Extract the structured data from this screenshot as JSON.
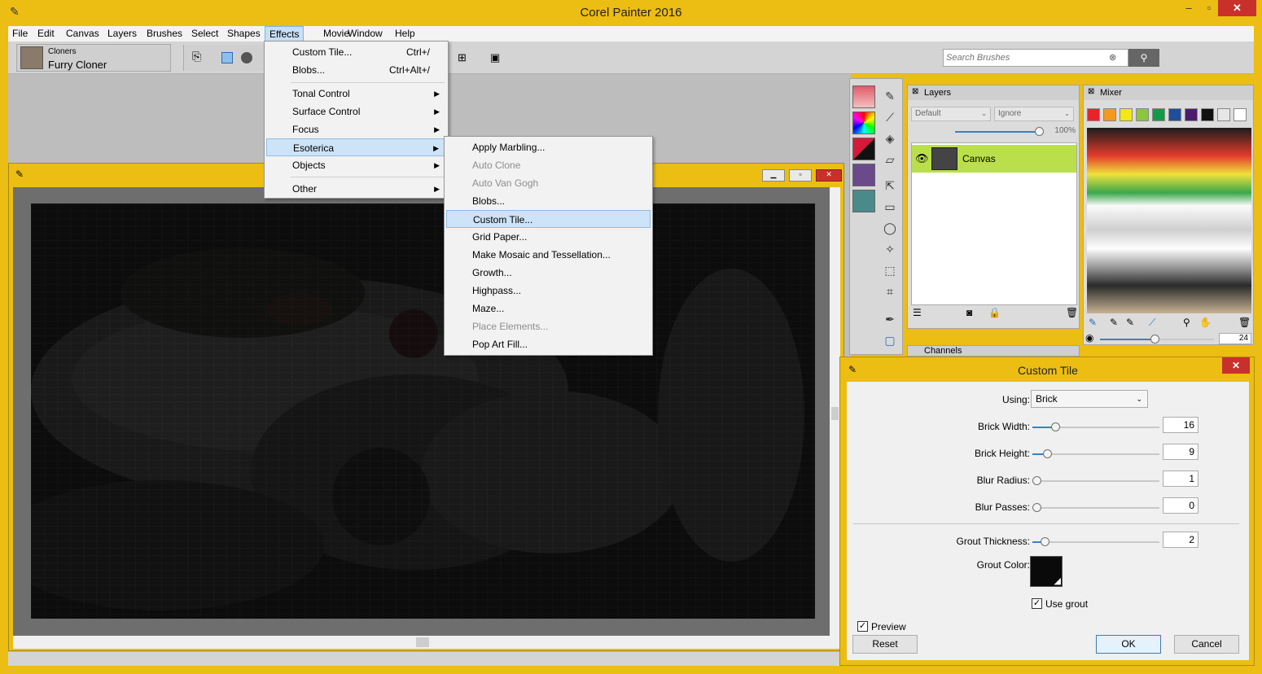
{
  "app": {
    "title": "Corel Painter 2016"
  },
  "window_controls": {
    "min": "‒",
    "max": "▫",
    "close": "✕"
  },
  "menubar": [
    "File",
    "Edit",
    "Canvas",
    "Layers",
    "Brushes",
    "Select",
    "Shapes",
    "Effects",
    "Movie",
    "Window",
    "Help"
  ],
  "brush": {
    "category": "Cloners",
    "variant": "Furry Cloner"
  },
  "search": {
    "placeholder": "Search Brushes"
  },
  "effects_menu": {
    "items": [
      {
        "label": "Custom Tile...",
        "shortcut": "Ctrl+/"
      },
      {
        "label": "Blobs...",
        "shortcut": "Ctrl+Alt+/"
      },
      {
        "label": "Tonal Control",
        "submenu": true
      },
      {
        "label": "Surface Control",
        "submenu": true
      },
      {
        "label": "Focus",
        "submenu": true
      },
      {
        "label": "Esoterica",
        "submenu": true,
        "highlighted": true
      },
      {
        "label": "Objects",
        "submenu": true
      },
      {
        "label": "Other",
        "submenu": true
      }
    ]
  },
  "esoterica_menu": {
    "items": [
      {
        "label": "Apply Marbling...",
        "enabled": true
      },
      {
        "label": "Auto Clone",
        "enabled": false
      },
      {
        "label": "Auto Van Gogh",
        "enabled": false
      },
      {
        "label": "Blobs...",
        "enabled": true
      },
      {
        "label": "Custom Tile...",
        "enabled": true,
        "highlighted": true
      },
      {
        "label": "Grid Paper...",
        "enabled": true
      },
      {
        "label": "Make Mosaic and Tessellation...",
        "enabled": true
      },
      {
        "label": "Growth...",
        "enabled": true
      },
      {
        "label": "Highpass...",
        "enabled": true
      },
      {
        "label": "Maze...",
        "enabled": true
      },
      {
        "label": "Place Elements...",
        "enabled": false
      },
      {
        "label": "Pop Art Fill...",
        "enabled": true
      }
    ]
  },
  "layers_panel": {
    "title": "Layers",
    "blend_mode": "Default",
    "composite": "Ignore",
    "opacity": "100%",
    "layer_name": "Canvas",
    "channels_title": "Channels"
  },
  "mixer_panel": {
    "title": "Mixer",
    "brush_size": "24",
    "colors": [
      "#e8242a",
      "#f39a1e",
      "#f5e617",
      "#8cc63f",
      "#139a48",
      "#1f4e9a",
      "#4b1d6b",
      "#111111",
      "#e6e6e6",
      "#ffffff"
    ]
  },
  "dialog": {
    "title": "Custom Tile",
    "using_label": "Using:",
    "using_value": "Brick",
    "brick_width_label": "Brick Width:",
    "brick_width": "16",
    "brick_width_level": 0.16,
    "brick_height_label": "Brick Height:",
    "brick_height": "9",
    "brick_height_level": 0.09,
    "blur_radius_label": "Blur Radius:",
    "blur_radius": "1",
    "blur_radius_level": 0.0,
    "blur_passes_label": "Blur Passes:",
    "blur_passes": "0",
    "blur_passes_level": 0.0,
    "grout_thickness_label": "Grout Thickness:",
    "grout_thickness": "2",
    "grout_thickness_level": 0.07,
    "grout_color_label": "Grout Color:",
    "grout_color": "#0a0a0a",
    "use_grout_label": "Use grout",
    "use_grout": true,
    "preview_label": "Preview",
    "preview": true,
    "reset_label": "Reset",
    "ok_label": "OK",
    "cancel_label": "Cancel"
  }
}
